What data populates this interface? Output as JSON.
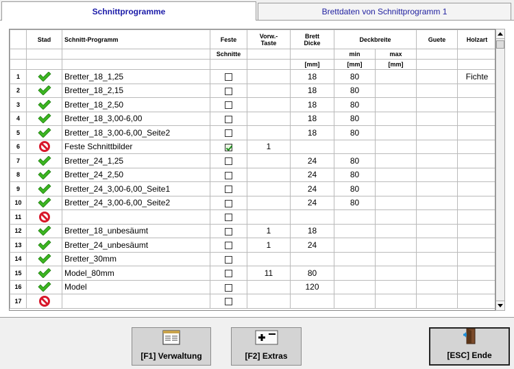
{
  "tabs": [
    {
      "label": "Schnittprogramme",
      "active": true
    },
    {
      "label": "Brettdaten von Schnittprogramm 1",
      "active": false
    }
  ],
  "grid": {
    "headers": {
      "stad": "Stad",
      "programm": "Schnitt-Programm",
      "feste": "Feste",
      "vorw": "Vorw.-\nTaste",
      "brett": "Brett\nDicke",
      "deckbreite": "Deckbreite",
      "guete": "Guete",
      "holzart": "Holzart"
    },
    "subheaders": {
      "feste": "Schnitte",
      "min": "min",
      "max": "max"
    },
    "units": {
      "brett": "[mm]",
      "min": "[mm]",
      "max": "[mm]"
    },
    "rows": [
      {
        "num": "1",
        "status": "ok",
        "name": "Bretter_18_1,25",
        "feste": false,
        "vorw": "",
        "dicke": "18",
        "min": "80",
        "max": "",
        "guete": "",
        "holzart": "Fichte"
      },
      {
        "num": "2",
        "status": "ok",
        "name": "Bretter_18_2,15",
        "feste": false,
        "vorw": "",
        "dicke": "18",
        "min": "80",
        "max": "",
        "guete": "",
        "holzart": ""
      },
      {
        "num": "3",
        "status": "ok",
        "name": "Bretter_18_2,50",
        "feste": false,
        "vorw": "",
        "dicke": "18",
        "min": "80",
        "max": "",
        "guete": "",
        "holzart": ""
      },
      {
        "num": "4",
        "status": "ok",
        "name": "Bretter_18_3,00-6,00",
        "feste": false,
        "vorw": "",
        "dicke": "18",
        "min": "80",
        "max": "",
        "guete": "",
        "holzart": ""
      },
      {
        "num": "5",
        "status": "ok",
        "name": "Bretter_18_3,00-6,00_Seite2",
        "feste": false,
        "vorw": "",
        "dicke": "18",
        "min": "80",
        "max": "",
        "guete": "",
        "holzart": ""
      },
      {
        "num": "6",
        "status": "no",
        "name": "Feste Schnittbilder",
        "feste": true,
        "vorw": "1",
        "dicke": "",
        "min": "",
        "max": "",
        "guete": "",
        "holzart": ""
      },
      {
        "num": "7",
        "status": "ok",
        "name": "Bretter_24_1,25",
        "feste": false,
        "vorw": "",
        "dicke": "24",
        "min": "80",
        "max": "",
        "guete": "",
        "holzart": ""
      },
      {
        "num": "8",
        "status": "ok",
        "name": "Bretter_24_2,50",
        "feste": false,
        "vorw": "",
        "dicke": "24",
        "min": "80",
        "max": "",
        "guete": "",
        "holzart": ""
      },
      {
        "num": "9",
        "status": "ok",
        "name": "Bretter_24_3,00-6,00_Seite1",
        "feste": false,
        "vorw": "",
        "dicke": "24",
        "min": "80",
        "max": "",
        "guete": "",
        "holzart": ""
      },
      {
        "num": "10",
        "status": "ok",
        "name": "Bretter_24_3,00-6,00_Seite2",
        "feste": false,
        "vorw": "",
        "dicke": "24",
        "min": "80",
        "max": "",
        "guete": "",
        "holzart": ""
      },
      {
        "num": "11",
        "status": "no",
        "name": "",
        "feste": false,
        "vorw": "",
        "dicke": "",
        "min": "",
        "max": "",
        "guete": "",
        "holzart": ""
      },
      {
        "num": "12",
        "status": "ok",
        "name": "Bretter_18_unbesäumt",
        "feste": false,
        "vorw": "1",
        "dicke": "18",
        "min": "",
        "max": "",
        "guete": "",
        "holzart": ""
      },
      {
        "num": "13",
        "status": "ok",
        "name": "Bretter_24_unbesäumt",
        "feste": false,
        "vorw": "1",
        "dicke": "24",
        "min": "",
        "max": "",
        "guete": "",
        "holzart": ""
      },
      {
        "num": "14",
        "status": "ok",
        "name": "Bretter_30mm",
        "feste": false,
        "vorw": "",
        "dicke": "",
        "min": "",
        "max": "",
        "guete": "",
        "holzart": ""
      },
      {
        "num": "15",
        "status": "ok",
        "name": "Model_80mm",
        "feste": false,
        "vorw": "11",
        "dicke": "80",
        "min": "",
        "max": "",
        "guete": "",
        "holzart": ""
      },
      {
        "num": "16",
        "status": "ok",
        "name": "Model",
        "feste": false,
        "vorw": "",
        "dicke": "120",
        "min": "",
        "max": "",
        "guete": "",
        "holzart": ""
      },
      {
        "num": "17",
        "status": "no",
        "name": "",
        "feste": false,
        "vorw": "",
        "dicke": "",
        "min": "",
        "max": "",
        "guete": "",
        "holzart": ""
      }
    ]
  },
  "buttons": {
    "f1": "[F1] Verwaltung",
    "f2": "[F2] Extras",
    "esc": "[ESC] Ende"
  },
  "icons": {
    "status_ok": "green-check-icon",
    "status_no": "red-prohibited-icon"
  },
  "colors": {
    "check_green": "#3cb521",
    "prohibited_red": "#d8172a",
    "tab_text": "#1a1aa8"
  }
}
